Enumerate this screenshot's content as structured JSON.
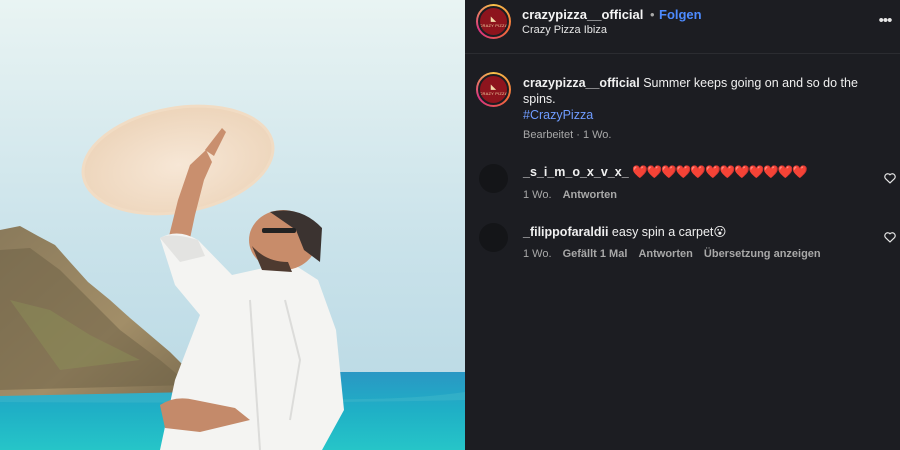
{
  "post": {
    "username": "crazypizza__official",
    "separator": "•",
    "follow_label": "Folgen",
    "location": "Crazy Pizza Ibiza",
    "more_label": "•••",
    "avatar_brand_text": "CRAZY PIZZA"
  },
  "caption": {
    "username": "crazypizza__official",
    "text": "Summer keeps going on and so do the spins.",
    "hashtag": "#CrazyPizza",
    "edited_label": "Bearbeitet",
    "dot": "·",
    "time": "1 Wo."
  },
  "comments": [
    {
      "username": "_s_i_m_o_x_v_x_",
      "text": "❤️❤️❤️❤️❤️❤️❤️❤️❤️❤️❤️❤️",
      "time": "1 Wo.",
      "reply_label": "Antworten"
    },
    {
      "username": "_filippofaraldii",
      "text": "easy spin a carpet😮",
      "time": "1 Wo.",
      "likes_label": "Gefällt 1 Mal",
      "reply_label": "Antworten",
      "translate_label": "Übersetzung anzeigen"
    }
  ],
  "colors": {
    "panel_bg": "#1c1d22",
    "link_blue": "#4d8bff",
    "hashtag_blue": "#6f9cff",
    "muted_text": "#a8a8a8"
  },
  "icons": [
    "more-options-icon",
    "heart-icon"
  ]
}
